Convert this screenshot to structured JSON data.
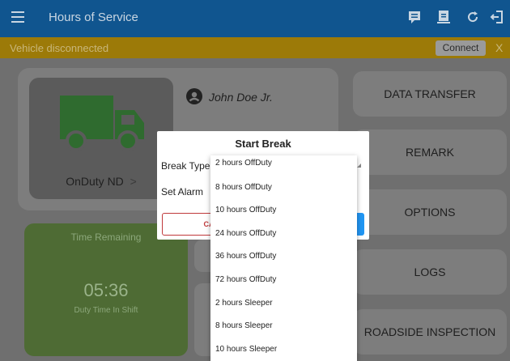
{
  "topbar": {
    "title": "Hours of Service",
    "icons": [
      "menu-icon",
      "message-icon",
      "document-icon",
      "refresh-icon",
      "logout-icon"
    ]
  },
  "banner": {
    "message": "Vehicle disconnected",
    "connect_label": "Connect",
    "close_label": "X"
  },
  "driver": {
    "name": "John Doe Jr.",
    "status": "OnDuty ND",
    "status_chevron": ">"
  },
  "time_card": {
    "label": "Time Remaining",
    "time": "05:36",
    "sub": "Duty Time In Shift"
  },
  "right_buttons": [
    "DATA TRANSFER",
    "REMARK",
    "OPTIONS",
    "LOGS",
    "ROADSIDE INSPECTION"
  ],
  "dialog": {
    "title": "Start Break",
    "break_type_label": "Break Type",
    "set_alarm_label": "Set Alarm",
    "cancel_label": "CAN"
  },
  "dropdown": {
    "options": [
      "2 hours OffDuty",
      "8 hours OffDuty",
      "10 hours OffDuty",
      "24 hours OffDuty",
      "36 hours OffDuty",
      "72 hours OffDuty",
      "2 hours Sleeper",
      "8 hours Sleeper",
      "10 hours Sleeper"
    ]
  },
  "colors": {
    "topbar": "#10558f",
    "banner": "#9c7a08",
    "time_card": "#4e6b34",
    "accent": "#2196f3",
    "cancel": "#c0393b"
  }
}
